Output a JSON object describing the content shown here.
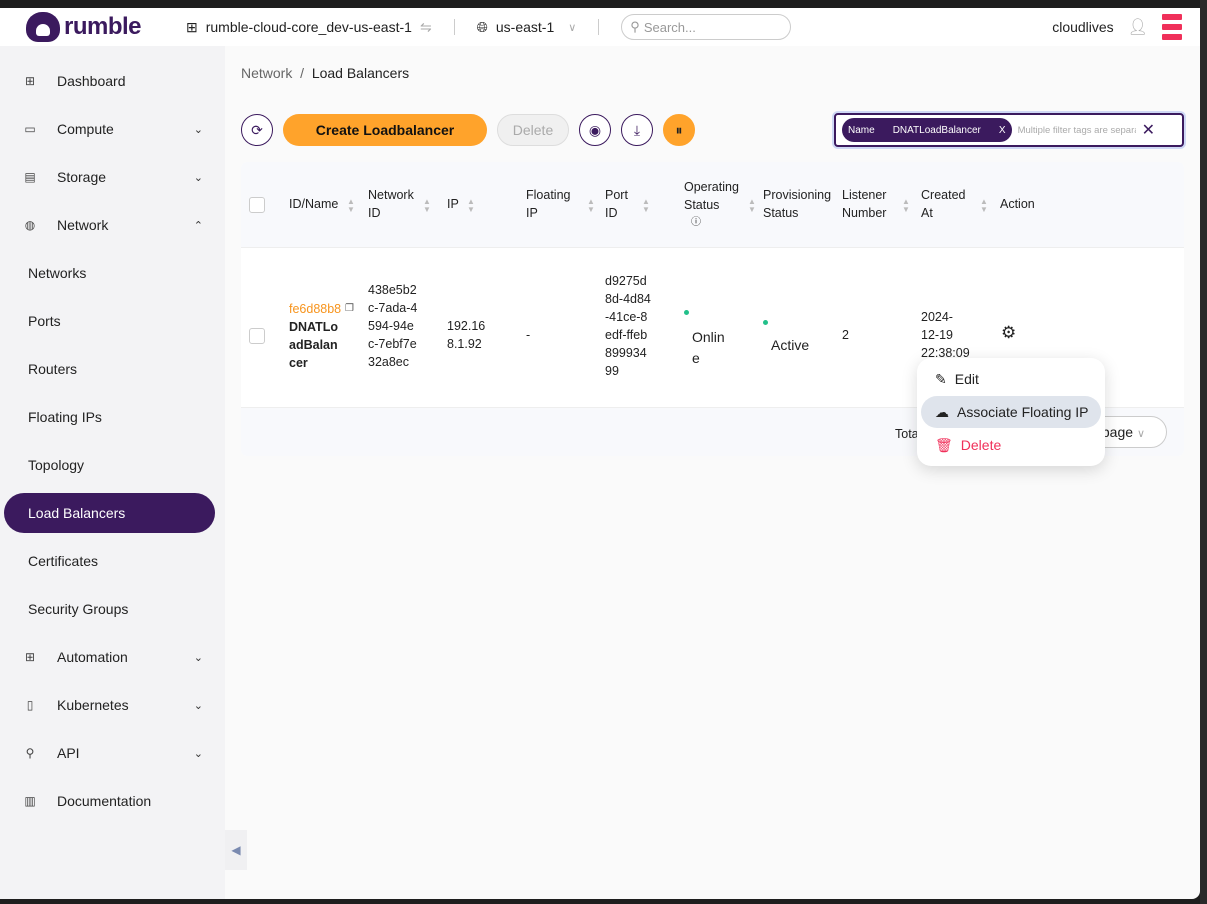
{
  "header": {
    "brand": "rumble",
    "project": "rumble-cloud-core_dev-us-east-1",
    "region": "us-east-1",
    "search_placeholder": "Search...",
    "username": "cloudlives"
  },
  "sidebar": {
    "items": [
      {
        "label": "Dashboard",
        "icon": "grid-icon",
        "type": "top"
      },
      {
        "label": "Compute",
        "icon": "monitor-icon",
        "type": "top",
        "chevron": "down"
      },
      {
        "label": "Storage",
        "icon": "storage-icon",
        "type": "top",
        "chevron": "down"
      },
      {
        "label": "Network",
        "icon": "globe-icon",
        "type": "top",
        "chevron": "up"
      },
      {
        "label": "Networks",
        "type": "sub"
      },
      {
        "label": "Ports",
        "type": "sub"
      },
      {
        "label": "Routers",
        "type": "sub"
      },
      {
        "label": "Floating IPs",
        "type": "sub"
      },
      {
        "label": "Topology",
        "type": "sub"
      },
      {
        "label": "Load Balancers",
        "type": "sub",
        "active": true
      },
      {
        "label": "Certificates",
        "type": "sub"
      },
      {
        "label": "Security Groups",
        "type": "sub"
      },
      {
        "label": "Automation",
        "icon": "grid-icon",
        "type": "top",
        "chevron": "down"
      },
      {
        "label": "Kubernetes",
        "icon": "document-icon",
        "type": "top",
        "chevron": "down"
      },
      {
        "label": "API",
        "icon": "plug-icon",
        "type": "top",
        "chevron": "down"
      },
      {
        "label": "Documentation",
        "icon": "book-icon",
        "type": "top"
      }
    ]
  },
  "breadcrumb": {
    "parent": "Network",
    "current": "Load Balancers"
  },
  "toolbar": {
    "create_label": "Create Loadbalancer",
    "delete_label": "Delete"
  },
  "filter": {
    "tag_key": "Name",
    "tag_value": "DNATLoadBalancer",
    "placeholder": "Multiple filter tags are separate"
  },
  "table": {
    "columns": [
      "ID/Name",
      "Network ID",
      "IP",
      "Floating IP",
      "Port ID",
      "Operating Status",
      "Provisioning Status",
      "Listener Number",
      "Created At",
      "Action"
    ],
    "rows": [
      {
        "id": "fe6d88b8",
        "name": "DNATLoadBalancer",
        "network_id": "438e5b2c-7ada-4594-94ec-7ebf7e32a8ec",
        "ip": "192.168.1.92",
        "floating_ip": "-",
        "port_id": "d9275d8d-4d84-41ce-8edf-ffeb89993499",
        "operating_status": "Online",
        "provisioning_status": "Active",
        "listener_number": "2",
        "created_at": "2024-12-19 22:38:09"
      }
    ],
    "footer_total": "Tota",
    "page_size": "/page"
  },
  "action_menu": {
    "items": [
      "Edit",
      "Associate Floating IP",
      "Delete"
    ],
    "delete_color": "#f0305a"
  },
  "colors": {
    "brand": "#3b1a5e",
    "accent": "#ffa32b",
    "status_ok": "#22c08a"
  }
}
